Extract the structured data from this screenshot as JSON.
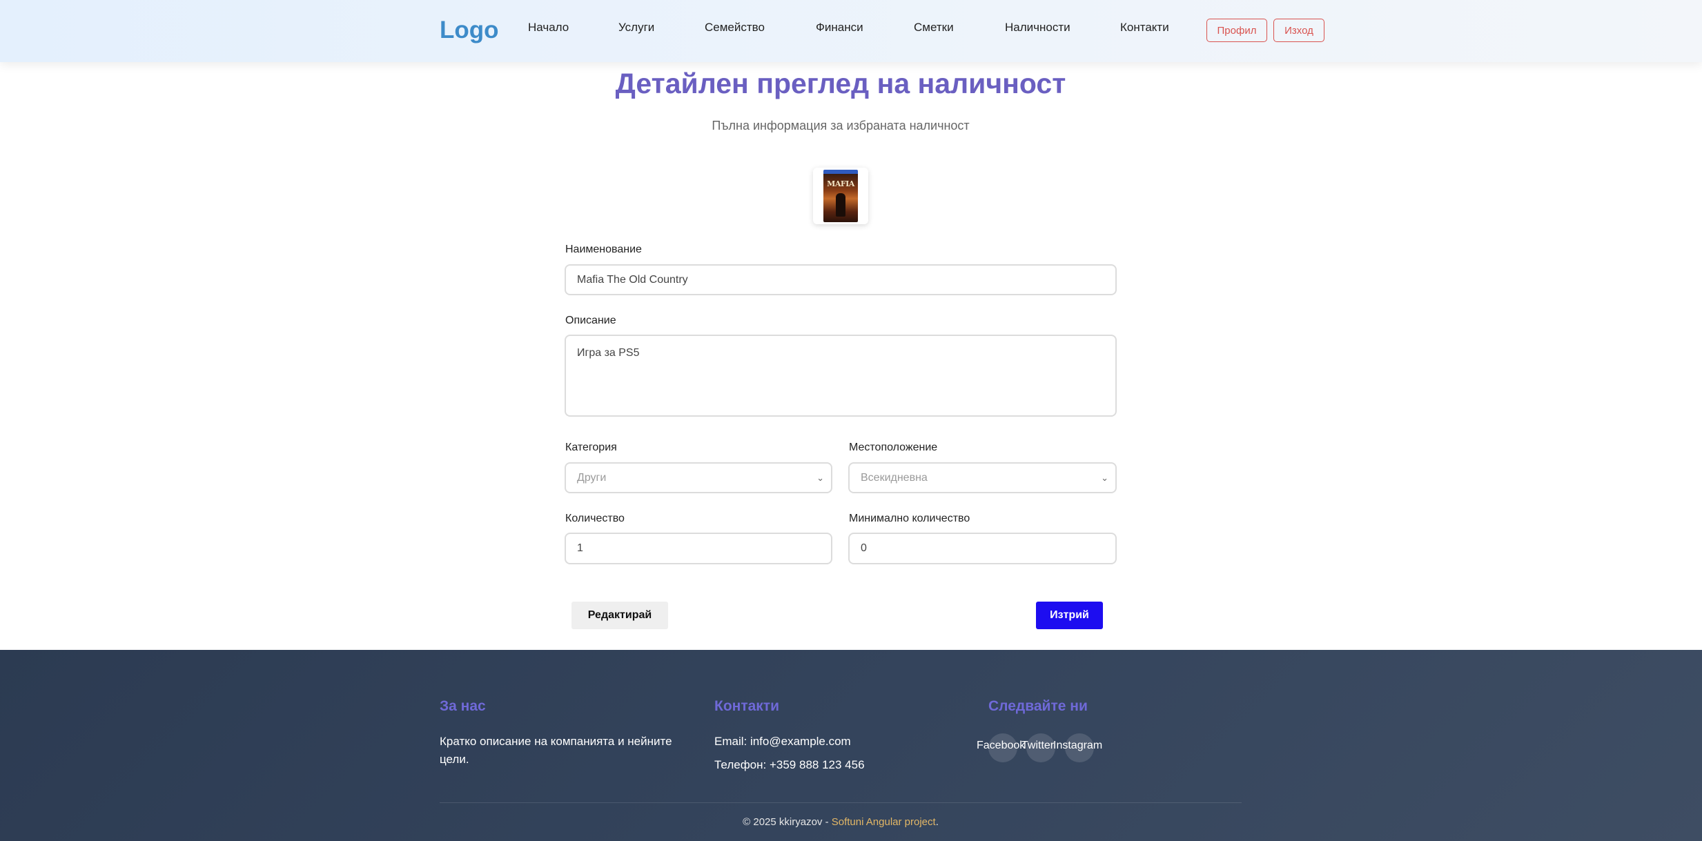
{
  "header": {
    "logo": "Logo",
    "nav": [
      "Начало",
      "Услуги",
      "Семейство",
      "Финанси",
      "Сметки",
      "Наличности",
      "Контакти"
    ],
    "profile_label": "Профил",
    "logout_label": "Изход"
  },
  "main": {
    "title": "Детайлен преглед на наличност",
    "subtitle": "Пълна информация за избраната наличност",
    "image": {
      "alt_icon": "game-cover-image",
      "cover_text": "MAFIA"
    },
    "fields": {
      "name_label": "Наименование",
      "name_value": "Mafia The Old Country",
      "description_label": "Описание",
      "description_value": "Игра за PS5",
      "category_label": "Категория",
      "category_value": "Други",
      "location_label": "Местоположение",
      "location_value": "Всекидневна",
      "quantity_label": "Количество",
      "quantity_value": "1",
      "min_quantity_label": "Минимално количество",
      "min_quantity_value": "0"
    },
    "edit_label": "Редактирай",
    "delete_label": "Изтрий"
  },
  "footer": {
    "about_heading": "За нас",
    "about_text": "Кратко описание на компанията и нейните цели.",
    "contacts_heading": "Контакти",
    "email": "Email: info@example.com",
    "phone": "Телефон: +359 888 123 456",
    "follow_heading": "Следвайте ни",
    "social": [
      "Facebook",
      "Twitter",
      "Instagram"
    ],
    "copyright_prefix": "© 2025 kkiryazov - ",
    "copyright_link": "Softuni Angular project",
    "copyright_suffix": "."
  },
  "colors": {
    "accent": "#6a5fc1",
    "logo": "#3d8bc9",
    "danger_outline": "#d9534f",
    "delete_button": "#1d0df0",
    "footer_bg": "#2c3b52",
    "footer_heading": "#6f69d8",
    "footer_link": "#e3b766"
  }
}
